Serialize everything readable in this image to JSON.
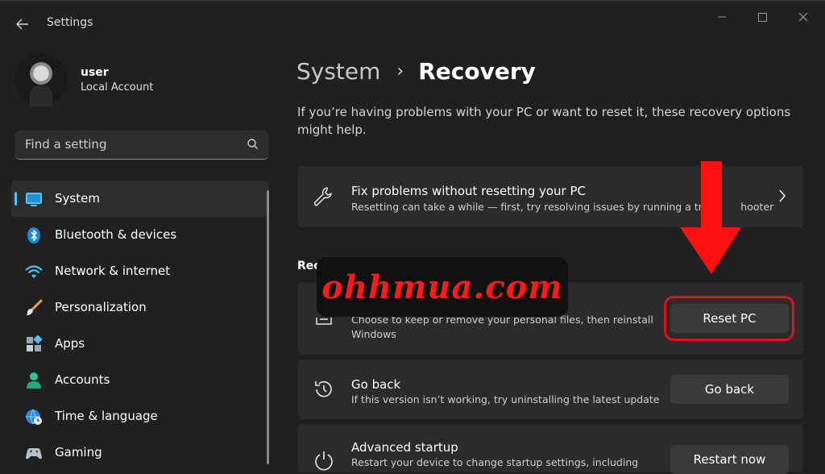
{
  "window": {
    "title": "Settings",
    "controls": [
      "minimize",
      "maximize",
      "close"
    ]
  },
  "profile": {
    "name": "user",
    "account_type": "Local Account"
  },
  "search": {
    "placeholder": "Find a setting"
  },
  "sidebar": {
    "items": [
      {
        "label": "System",
        "icon": "system-icon",
        "active": true
      },
      {
        "label": "Bluetooth & devices",
        "icon": "bluetooth-icon",
        "active": false
      },
      {
        "label": "Network & internet",
        "icon": "wifi-icon",
        "active": false
      },
      {
        "label": "Personalization",
        "icon": "brush-icon",
        "active": false
      },
      {
        "label": "Apps",
        "icon": "apps-icon",
        "active": false
      },
      {
        "label": "Accounts",
        "icon": "person-icon",
        "active": false
      },
      {
        "label": "Time & language",
        "icon": "globe-clock-icon",
        "active": false
      },
      {
        "label": "Gaming",
        "icon": "gamepad-icon",
        "active": false
      }
    ]
  },
  "main": {
    "breadcrumb": {
      "parent": "System",
      "separator": "›",
      "current": "Recovery"
    },
    "description": "If you’re having problems with your PC or want to reset it, these recovery options might help.",
    "fix_card": {
      "title": "Fix problems without resetting your PC",
      "desc": "Resetting can take a while — first, try resolving issues by running a tro",
      "desc_tail": "hooter"
    },
    "section_label": "Rec",
    "reset_card": {
      "desc_line1": "Choose to keep or remove your personal files, then reinstall",
      "desc_line2": "Windows",
      "button": "Reset PC"
    },
    "goback_card": {
      "title": "Go back",
      "desc": "If this version isn’t working, try uninstalling the latest update",
      "button": "Go back"
    },
    "advanced_card": {
      "title": "Advanced startup",
      "desc": "Restart your device to change startup settings, including",
      "button": "Restart now"
    }
  },
  "overlay": {
    "watermark": "ohhmua.com",
    "highlight_color": "#e0111b",
    "arrow_color": "#ff1010"
  },
  "colors": {
    "background": "#202020",
    "card": "#2b2b2b",
    "accent": "#4cc2ff"
  }
}
